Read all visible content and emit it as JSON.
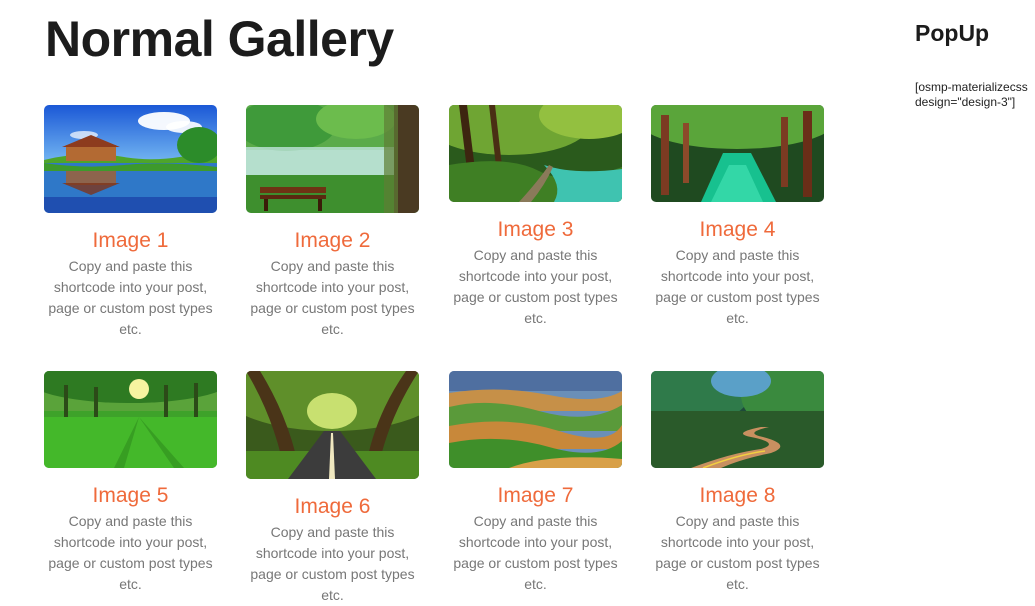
{
  "gallery": {
    "title": "Normal Gallery",
    "items": [
      {
        "title": "Image 1",
        "description": "Copy and paste this shortcode into your post, page or custom post types etc.",
        "image": "house-lake-reflection"
      },
      {
        "title": "Image 2",
        "description": "Copy and paste this shortcode into your post, page or custom post types etc.",
        "image": "bench-by-lake"
      },
      {
        "title": "Image 3",
        "description": "Copy and paste this shortcode into your post, page or custom post types etc.",
        "image": "forest-river-path"
      },
      {
        "title": "Image 4",
        "description": "Copy and paste this shortcode into your post, page or custom post types etc.",
        "image": "green-forest-canal"
      },
      {
        "title": "Image 5",
        "description": "Copy and paste this shortcode into your post, page or custom post types etc.",
        "image": "sunlit-green-park"
      },
      {
        "title": "Image 6",
        "description": "Copy and paste this shortcode into your post, page or custom post types etc.",
        "image": "tree-tunnel-road"
      },
      {
        "title": "Image 7",
        "description": "Copy and paste this shortcode into your post, page or custom post types etc.",
        "image": "rolling-hills"
      },
      {
        "title": "Image 8",
        "description": "Copy and paste this shortcode into your post, page or custom post types etc.",
        "image": "winding-road-forest"
      }
    ]
  },
  "sidebar": {
    "title": "PopUp",
    "shortcode": "[osmp-materializecss\ndesign=\"design-3\"]"
  },
  "colors": {
    "title_text": "#1c1c1c",
    "accent": "#ef6a3b",
    "description_text": "#777777"
  }
}
